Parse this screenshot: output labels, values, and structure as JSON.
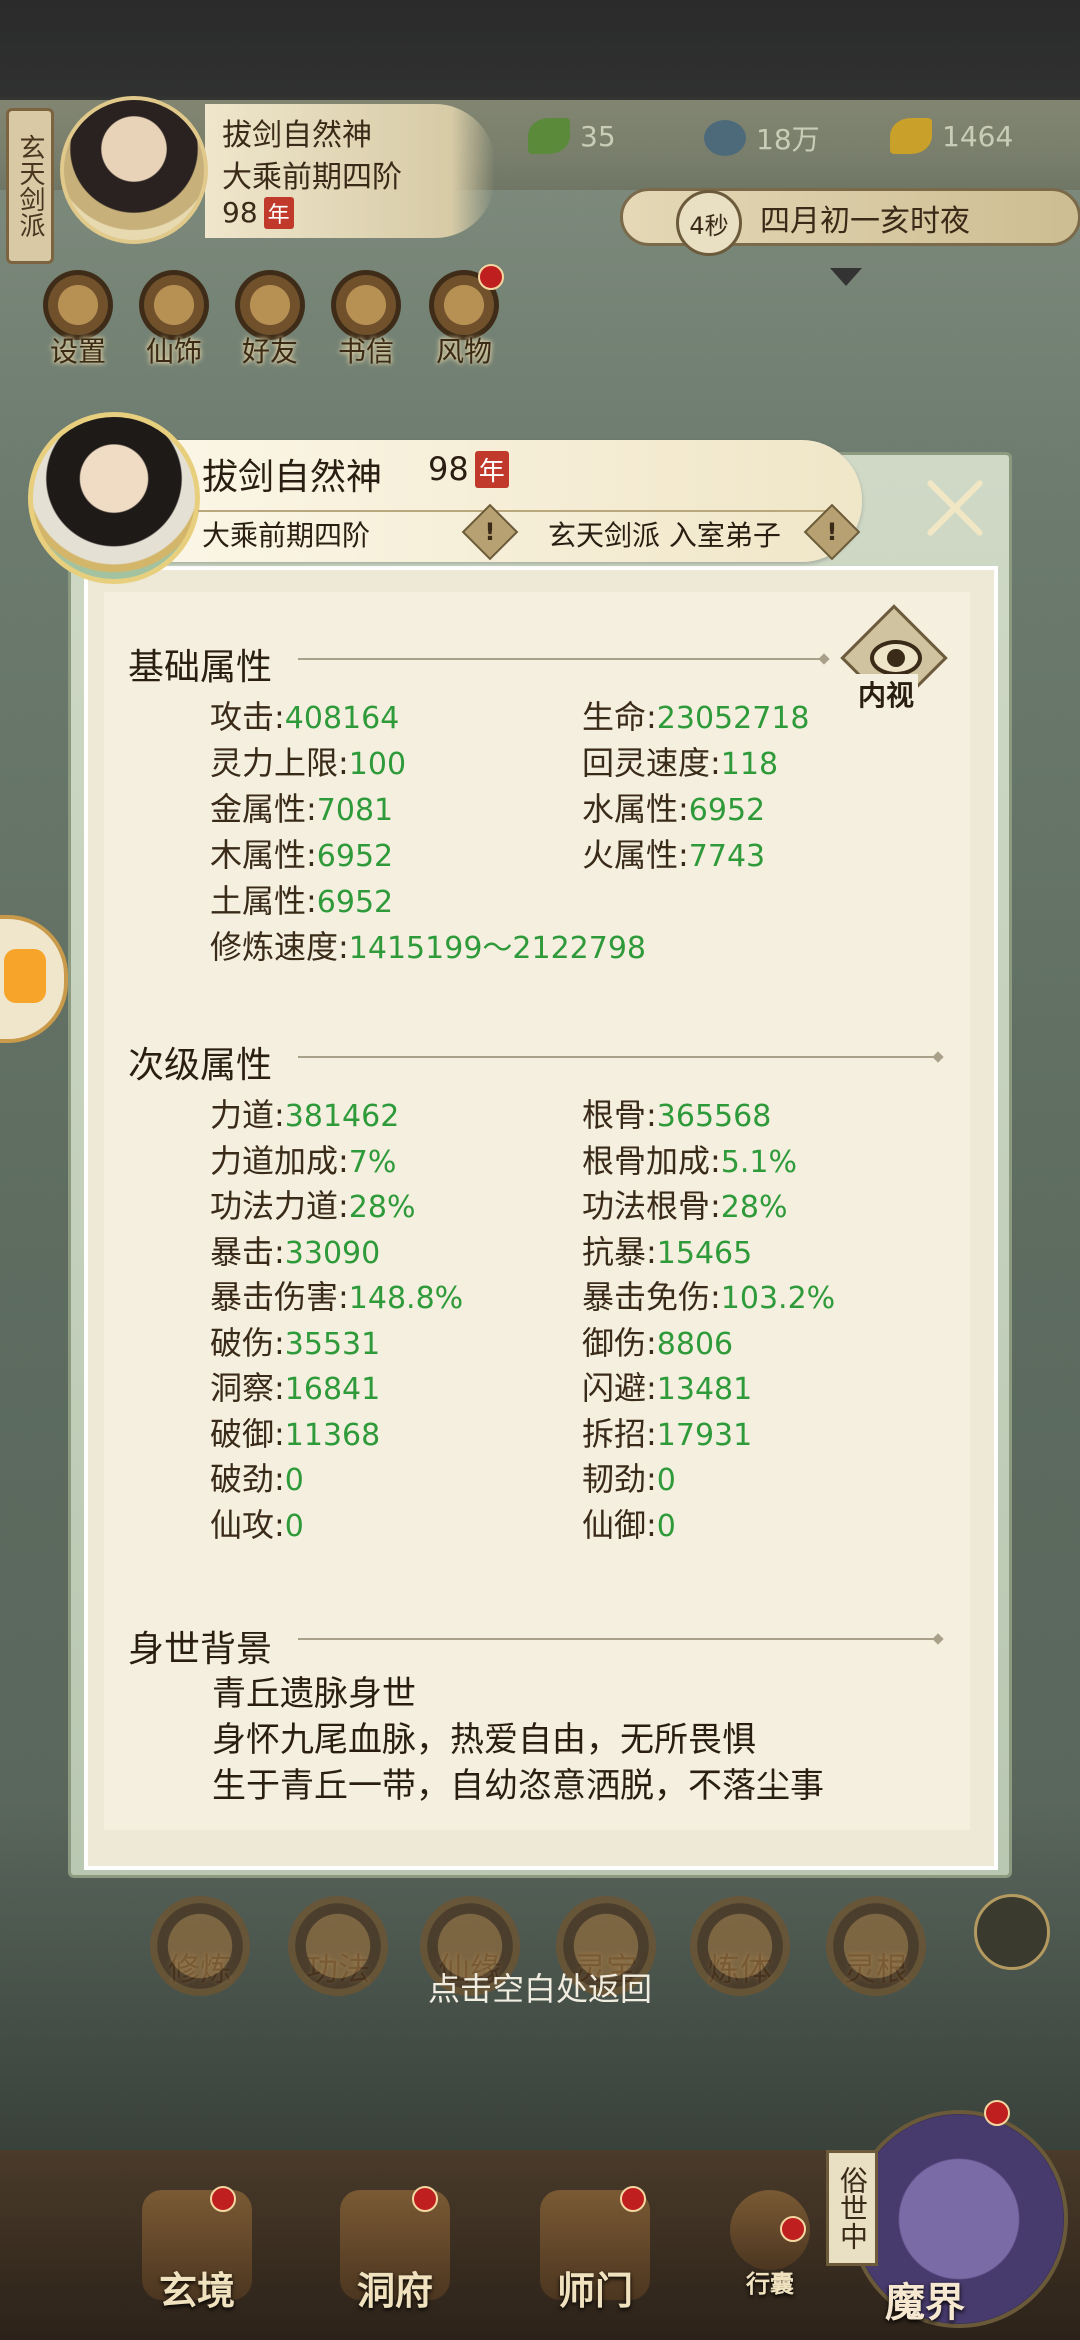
{
  "top": {
    "sect_tag": "玄天剑派",
    "player_name": "拔剑自然神",
    "realm": "大乘前期四阶",
    "age": "98",
    "age_unit": "年",
    "resources": [
      {
        "icon": "leaf-icon",
        "value": "35"
      },
      {
        "icon": "coin-icon",
        "value": "18万"
      },
      {
        "icon": "ingot-icon",
        "value": "1464"
      }
    ],
    "timer": "4秒",
    "game_time": "四月初一亥时夜"
  },
  "menu": [
    {
      "label": "设置",
      "icon": "settings-icon"
    },
    {
      "label": "仙饰",
      "icon": "ornament-icon"
    },
    {
      "label": "好友",
      "icon": "friends-icon"
    },
    {
      "label": "书信",
      "icon": "letter-icon"
    },
    {
      "label": "风物",
      "icon": "scenery-icon"
    }
  ],
  "panel": {
    "name": "拔剑自然神",
    "age": "98",
    "age_unit": "年",
    "realm": "大乘前期四阶",
    "sect": "玄天剑派 入室弟子",
    "inner_view_label": "内视",
    "basic_title": "基础属性",
    "basic": {
      "atk": {
        "k": "攻击",
        "v": "408164"
      },
      "hp": {
        "k": "生命",
        "v": "23052718"
      },
      "sp": {
        "k": "灵力上限",
        "v": "100"
      },
      "regen": {
        "k": "回灵速度",
        "v": "118"
      },
      "metal": {
        "k": "金属性",
        "v": "7081"
      },
      "water": {
        "k": "水属性",
        "v": "6952"
      },
      "wood": {
        "k": "木属性",
        "v": "6952"
      },
      "fire": {
        "k": "火属性",
        "v": "7743"
      },
      "earth": {
        "k": "土属性",
        "v": "6952"
      },
      "cult": {
        "k": "修炼速度",
        "v": "1415199～2122798"
      }
    },
    "secondary_title": "次级属性",
    "secondary": [
      {
        "k": "力道",
        "v": "381462"
      },
      {
        "k": "根骨",
        "v": "365568"
      },
      {
        "k": "力道加成",
        "v": "7%"
      },
      {
        "k": "根骨加成",
        "v": "5.1%"
      },
      {
        "k": "功法力道",
        "v": "28%"
      },
      {
        "k": "功法根骨",
        "v": "28%"
      },
      {
        "k": "暴击",
        "v": "33090"
      },
      {
        "k": "抗暴",
        "v": "15465"
      },
      {
        "k": "暴击伤害",
        "v": "148.8%"
      },
      {
        "k": "暴击免伤",
        "v": "103.2%"
      },
      {
        "k": "破伤",
        "v": "35531"
      },
      {
        "k": "御伤",
        "v": "8806"
      },
      {
        "k": "洞察",
        "v": "16841"
      },
      {
        "k": "闪避",
        "v": "13481"
      },
      {
        "k": "破御",
        "v": "11368"
      },
      {
        "k": "拆招",
        "v": "17931"
      },
      {
        "k": "破劲",
        "v": "0"
      },
      {
        "k": "韧劲",
        "v": "0"
      },
      {
        "k": "仙攻",
        "v": "0"
      },
      {
        "k": "仙御",
        "v": "0"
      }
    ],
    "bio_title": "身世背景",
    "bio": [
      "青丘遗脉身世",
      "身怀九尾血脉，热爱自由，无所畏惧",
      "生于青丘一带，自幼恣意洒脱，不落尘事"
    ]
  },
  "skills": [
    "修炼",
    "功法",
    "仙缘",
    "灵宝",
    "炼体",
    "灵根"
  ],
  "return_hint": "点击空白处返回",
  "bottom_nav": [
    {
      "label": "玄境",
      "icon": "realm-icon"
    },
    {
      "label": "洞府",
      "icon": "cave-icon"
    },
    {
      "label": "师门",
      "icon": "sect-icon"
    },
    {
      "label": "行囊",
      "icon": "bag-icon"
    }
  ],
  "world_switch": {
    "tag": "俗世中",
    "label": "魔界"
  },
  "colors": {
    "value_green": "#2f9a3a",
    "badge_red": "#c0392b",
    "panel_paper": "#f4efdf"
  }
}
